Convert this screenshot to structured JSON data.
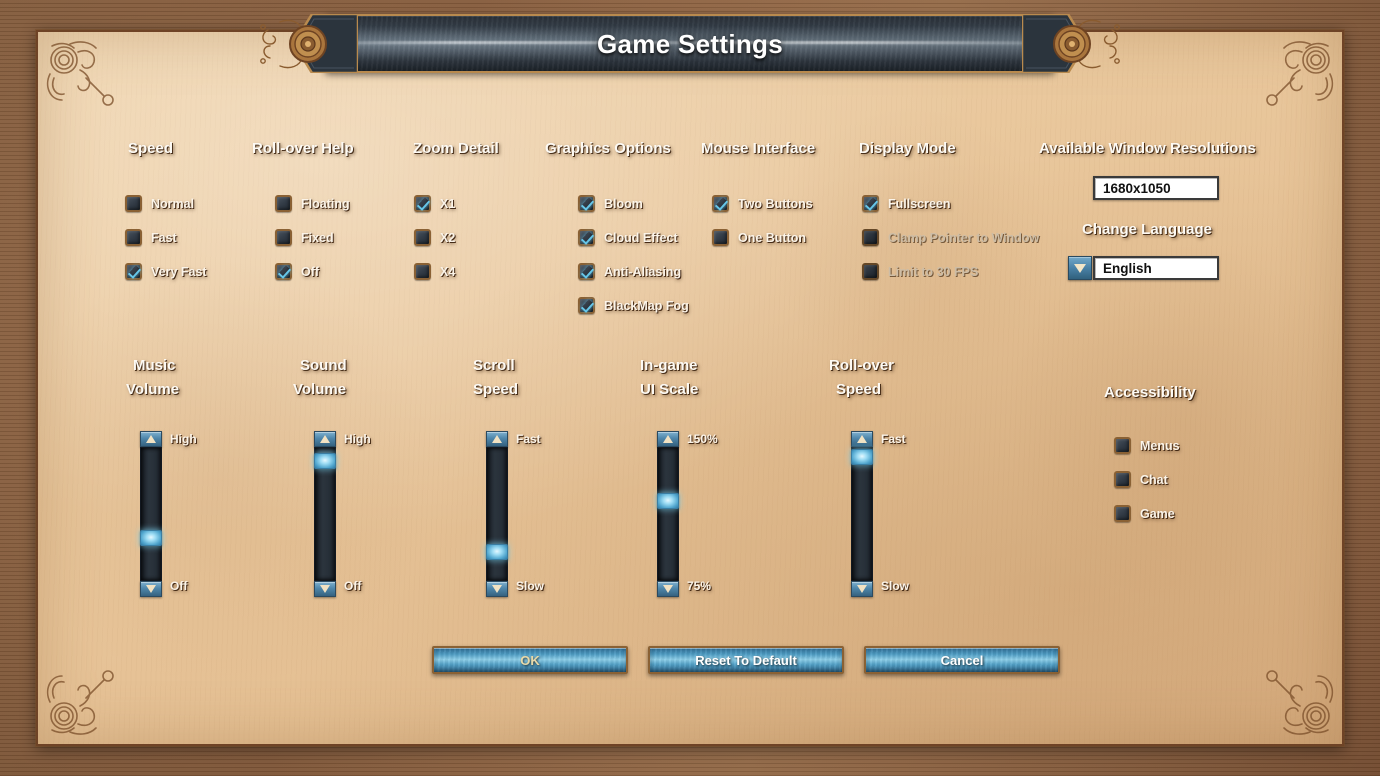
{
  "window": {
    "title": "Game Settings"
  },
  "columns": {
    "speed": {
      "heading": "Speed",
      "options": [
        {
          "label": "Normal",
          "checked": false
        },
        {
          "label": "Fast",
          "checked": false
        },
        {
          "label": "Very Fast",
          "checked": true
        }
      ]
    },
    "rollover_help": {
      "heading": "Roll-over Help",
      "options": [
        {
          "label": "Floating",
          "checked": false
        },
        {
          "label": "Fixed",
          "checked": false
        },
        {
          "label": "Off",
          "checked": true
        }
      ]
    },
    "zoom_detail": {
      "heading": "Zoom Detail",
      "options": [
        {
          "label": "X1",
          "checked": true
        },
        {
          "label": "X2",
          "checked": false
        },
        {
          "label": "X4",
          "checked": false
        }
      ]
    },
    "graphics_options": {
      "heading": "Graphics Options",
      "options": [
        {
          "label": "Bloom",
          "checked": true
        },
        {
          "label": "Cloud Effect",
          "checked": true
        },
        {
          "label": "Anti-Aliasing",
          "checked": true
        },
        {
          "label": "BlackMap Fog",
          "checked": true
        }
      ]
    },
    "mouse_interface": {
      "heading": "Mouse Interface",
      "options": [
        {
          "label": "Two Buttons",
          "checked": true
        },
        {
          "label": "One Button",
          "checked": false
        }
      ]
    },
    "display_mode": {
      "heading": "Display Mode",
      "options": [
        {
          "label": "Fullscreen",
          "checked": true,
          "dim": false
        },
        {
          "label": "Clamp Pointer to Window",
          "checked": false,
          "dim": true
        },
        {
          "label": "Limit to 30 FPS",
          "checked": false,
          "dim": true
        }
      ]
    },
    "resolutions": {
      "heading": "Available Window Resolutions",
      "value": "1680x1050"
    },
    "language": {
      "heading": "Change Language",
      "value": "English"
    },
    "accessibility": {
      "heading": "Accessibility",
      "options": [
        {
          "label": "Menus",
          "checked": false
        },
        {
          "label": "Chat",
          "checked": false
        },
        {
          "label": "Game",
          "checked": false
        }
      ]
    }
  },
  "sliders": [
    {
      "heading_line1": "Music",
      "heading_line2": "Volume",
      "top_label": "High",
      "bottom_label": "Off",
      "value_pct": 30
    },
    {
      "heading_line1": "Sound",
      "heading_line2": "Volume",
      "top_label": "High",
      "bottom_label": "Off",
      "value_pct": 92
    },
    {
      "heading_line1": "Scroll",
      "heading_line2": "Speed",
      "top_label": "Fast",
      "bottom_label": "Slow",
      "value_pct": 24
    },
    {
      "heading_line1": "In-game",
      "heading_line2": "UI Scale",
      "top_label": "150%",
      "bottom_label": "75%",
      "value_pct": 62
    },
    {
      "heading_line1": "Roll-over",
      "heading_line2": "Speed",
      "top_label": "Fast",
      "bottom_label": "Slow",
      "value_pct": 96
    }
  ],
  "buttons": [
    {
      "label": "OK",
      "hot": true
    },
    {
      "label": "Reset To Default",
      "hot": false
    },
    {
      "label": "Cancel",
      "hot": false
    }
  ],
  "icons": {
    "checkmark": "check-icon",
    "dropdown": "chevron-down-icon",
    "slider_up": "triangle-up-icon",
    "slider_down": "triangle-down-icon",
    "corner": "filigree-ornament-icon",
    "medallion": "medallion-ornament-icon"
  },
  "colors": {
    "parchment": "#e9c79c",
    "frame": "#9b6b45",
    "accent_blue": "#66c6e8",
    "gold": "#b98a4e"
  }
}
